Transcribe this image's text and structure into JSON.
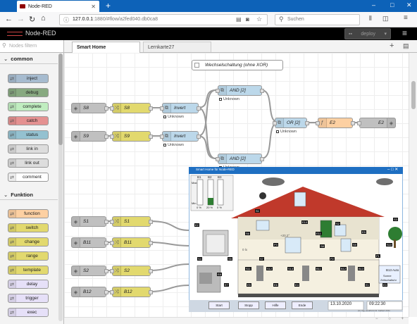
{
  "browser": {
    "tab_title": "Node-RED",
    "new_tab": "+",
    "url_host": "127.0.0.1",
    "url_rest": ":1880/#flow/a2fed040.db0ca8",
    "search_placeholder": "Suchen",
    "window_controls": [
      "–",
      "□",
      "✕"
    ]
  },
  "nodered": {
    "brand": "Node-RED",
    "deploy_label": "deploy",
    "filter_placeholder": "Nodes filtern",
    "flow_tabs": [
      {
        "label": "Smart Home",
        "active": true
      },
      {
        "label": "Lernkarte27",
        "active": false
      }
    ]
  },
  "palette": {
    "categories": [
      {
        "label": "common"
      },
      {
        "label": "Funktion"
      }
    ],
    "common_nodes": [
      {
        "label": "inject",
        "color": "#a6bbcf"
      },
      {
        "label": "debug",
        "color": "#87a980"
      },
      {
        "label": "complete",
        "color": "#c0edc0"
      },
      {
        "label": "catch",
        "color": "#e49191"
      },
      {
        "label": "status",
        "color": "#94c1d0"
      },
      {
        "label": "link in",
        "color": "#dddddd"
      },
      {
        "label": "link out",
        "color": "#dddddd"
      },
      {
        "label": "comment",
        "color": "#ffffff"
      }
    ],
    "function_nodes": [
      {
        "label": "function",
        "color": "#fdd0a2"
      },
      {
        "label": "switch",
        "color": "#e2d96e"
      },
      {
        "label": "change",
        "color": "#e2d96e"
      },
      {
        "label": "range",
        "color": "#e2d96e"
      },
      {
        "label": "template",
        "color": "#e2d96e"
      },
      {
        "label": "delay",
        "color": "#e6e0f8"
      },
      {
        "label": "trigger",
        "color": "#e6e0f8"
      },
      {
        "label": "exec",
        "color": "#e6e0f8"
      }
    ]
  },
  "flow": {
    "comment": "Wechselschaltung (ohne XOR)",
    "status_unknown": "Unknown",
    "inputs_top": [
      {
        "label": "S8"
      },
      {
        "label": "S9"
      }
    ],
    "switches_top": [
      {
        "label": "S8"
      },
      {
        "label": "S9"
      }
    ],
    "invert_label": "Invert",
    "and_label": "AND [2]",
    "or_label": "OR [2]",
    "func_label": "E2",
    "out_label": "E2",
    "inputs_bottom": [
      {
        "label": "S1"
      },
      {
        "label": "B11"
      },
      {
        "label": "S2"
      },
      {
        "label": "B12"
      }
    ],
    "switches_bottom": [
      {
        "label": "S1"
      },
      {
        "label": "B11"
      },
      {
        "label": "S2"
      },
      {
        "label": "B12"
      }
    ]
  },
  "panel": {
    "title": "Smart Home für Node-RED",
    "sensors": [
      "B1",
      "B2",
      "B3"
    ],
    "sensor_scale": [
      "Max",
      "Min"
    ],
    "sensor_pct": [
      "0 %",
      "20 %",
      "0 %"
    ],
    "labels_misc": [
      "E2",
      "S1",
      "S2",
      "S3",
      "S4",
      "S5",
      "S6",
      "S7",
      "S8",
      "S9",
      "S10",
      "S11",
      "S12",
      "S13",
      "B11",
      "B12",
      "B13",
      "E1",
      "E3",
      "E4",
      "E5",
      "E6",
      "E7",
      "E8",
      "E9",
      "E10",
      "E11",
      "P1",
      "P2",
      "P3"
    ],
    "auto_label": "B13 Auto",
    "sonne_label": "Sonne",
    "schalt_label": "Zeitschaltuhr",
    "buttons": [
      {
        "label": "Start"
      },
      {
        "label": "Stopp"
      },
      {
        "label": "Hilfe"
      },
      {
        "label": "Ende"
      }
    ],
    "date": "13.10.2020",
    "time": "09:22:30",
    "copyright": "(C) Ingenieurbüro Dr. Kahlert 2011",
    "value_temp": "+20.2°",
    "value_lux": "0 lx"
  },
  "colors": {
    "tab_blue": "#0d62b8",
    "nr_header": "#000000",
    "panel_blue": "#1e6fc2"
  }
}
